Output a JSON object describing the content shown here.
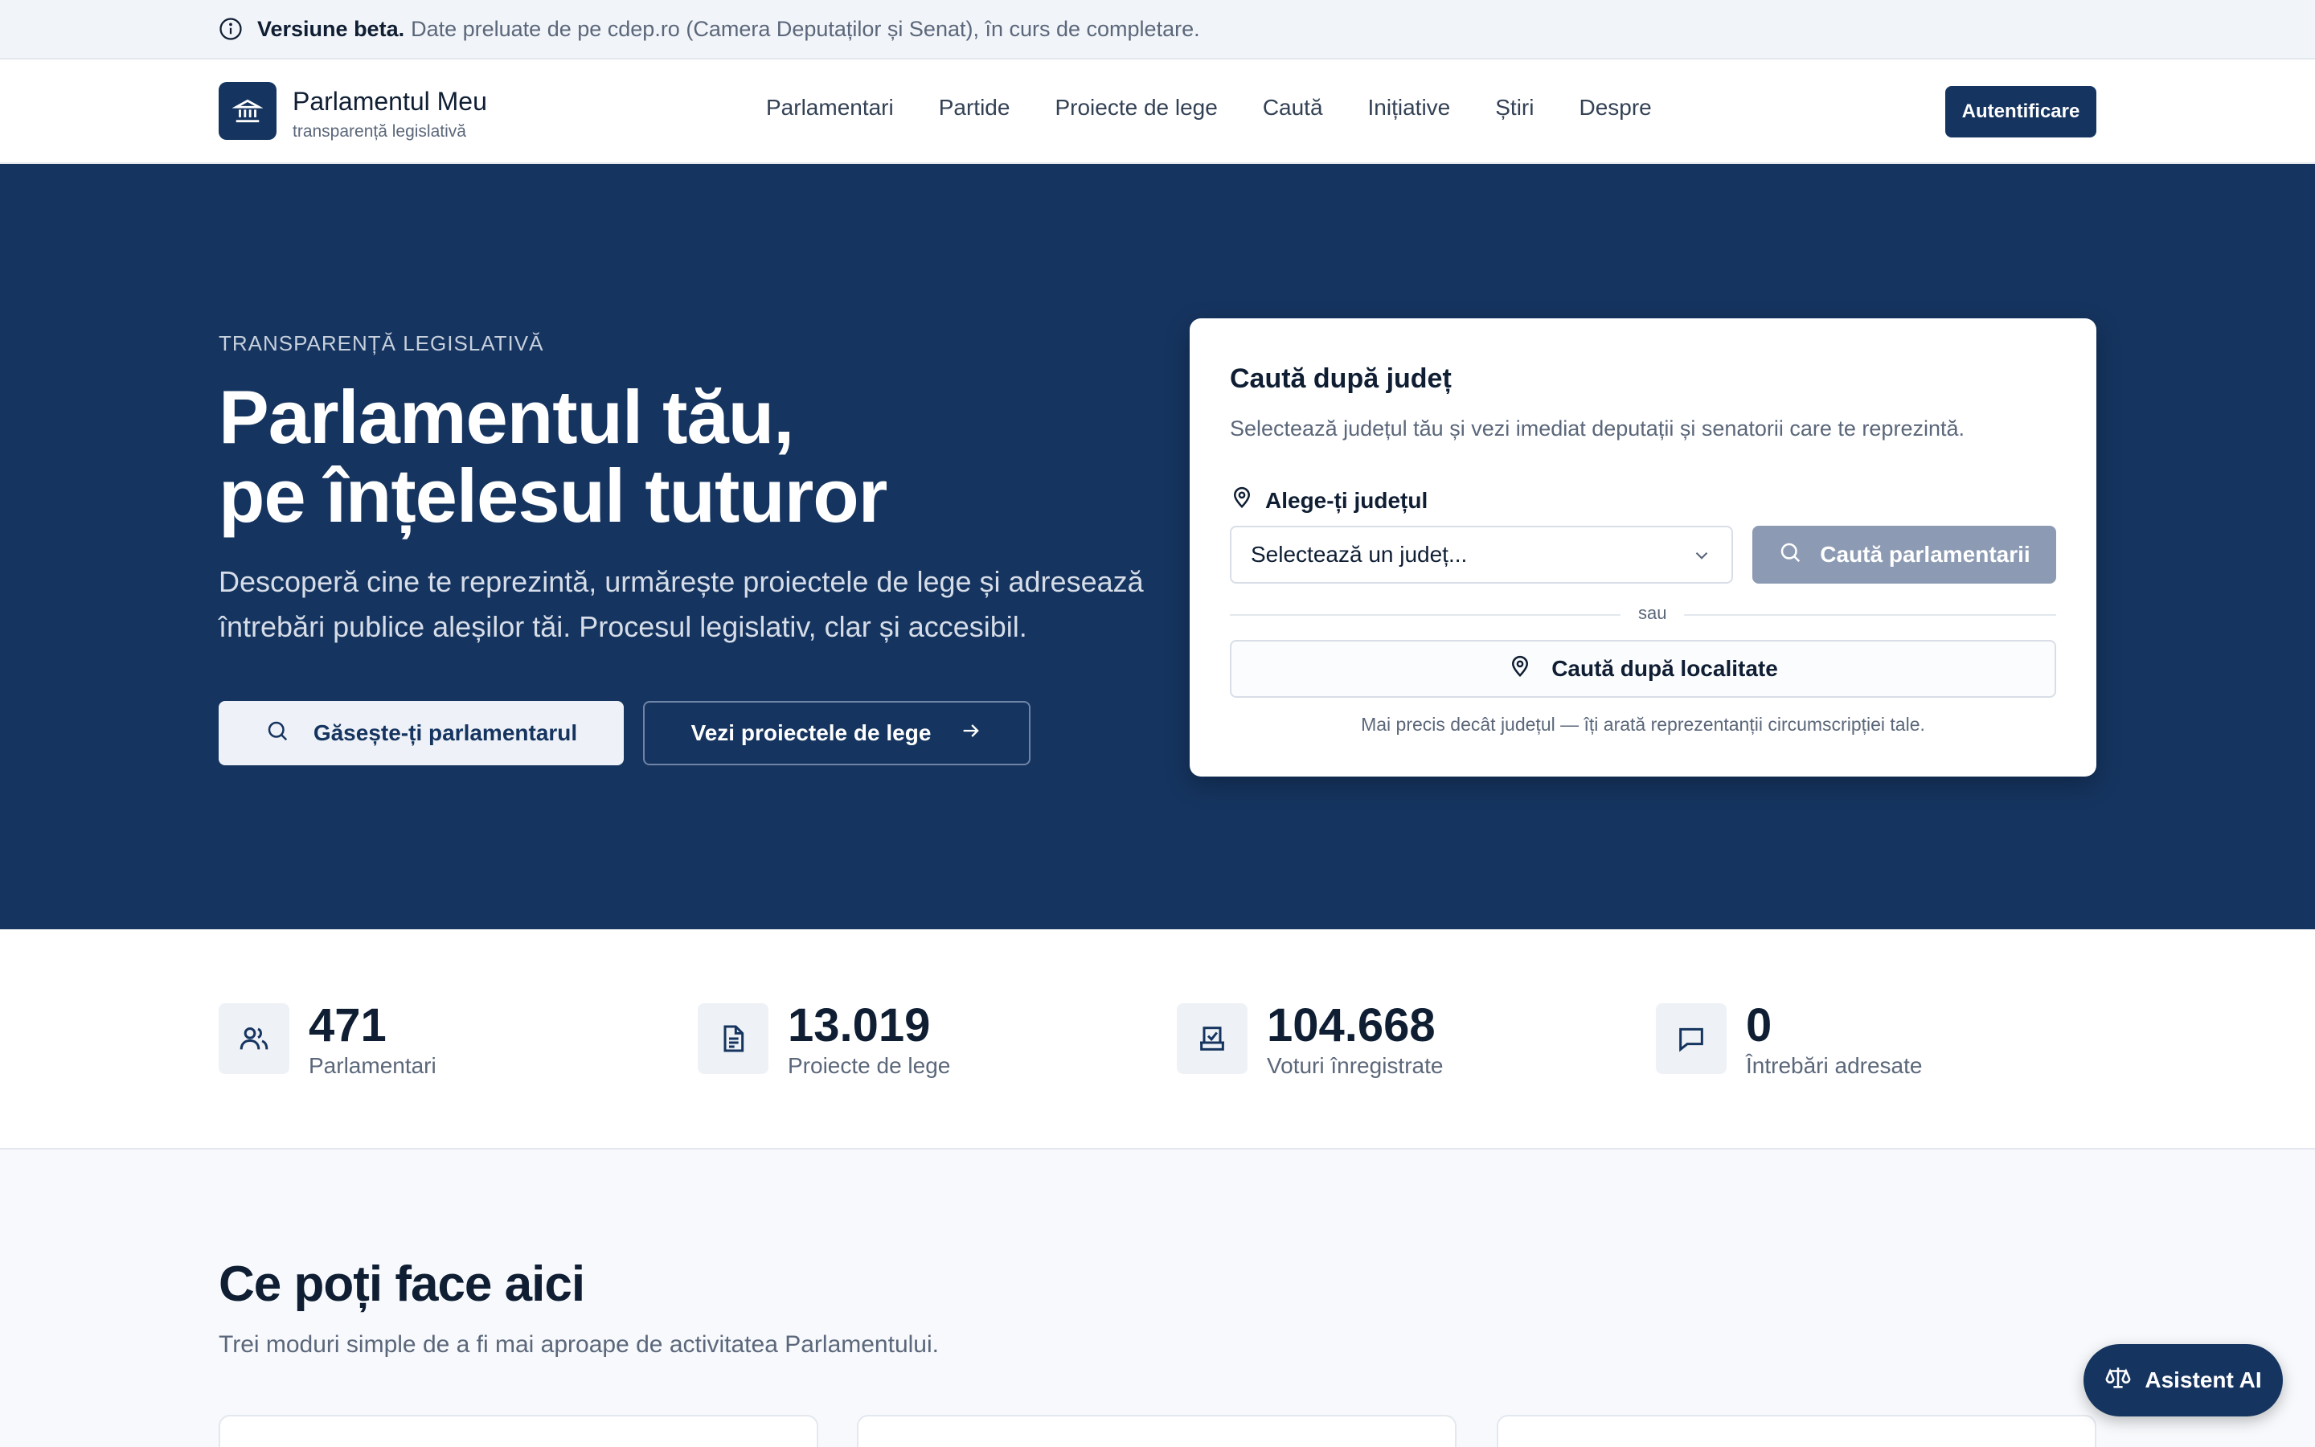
{
  "beta_bar": {
    "icon": "info-icon",
    "label": "Versiune beta.",
    "text": "Date preluate de pe cdep.ro (Camera Deputaților și Senat), în curs de completare."
  },
  "header": {
    "logo_icon": "institution-icon",
    "title": "Parlamentul Meu",
    "subtitle": "transparență legislativă",
    "nav": [
      "Parlamentari",
      "Partide",
      "Proiecte de lege",
      "Caută",
      "Inițiative",
      "Știri",
      "Despre"
    ],
    "login_label": "Autentificare"
  },
  "hero": {
    "eyebrow": "TRANSPARENȚĂ LEGISLATIVĂ",
    "title_line1": "Parlamentul tău,",
    "title_line2": "pe înțelesul tuturor",
    "description": "Descoperă cine te reprezintă, urmărește proiectele de lege și adresează întrebări publice aleșilor tăi. Procesul legislativ, clar și accesibil.",
    "find_button": "Găsește-ți parlamentarul",
    "projects_button": "Vezi proiectele de lege"
  },
  "search_card": {
    "title": "Caută după județ",
    "description": "Selectează județul tău și vezi imediat deputații și senatorii care te reprezintă.",
    "county_label": "Alege-ți județul",
    "select_placeholder": "Selectează un județ...",
    "search_button": "Caută parlamentarii",
    "divider": "sau",
    "locality_button": "Caută după localitate",
    "hint": "Mai precis decât județul — îți arată reprezentanții circumscripției tale."
  },
  "stats": [
    {
      "icon": "users-icon",
      "value": "471",
      "label": "Parlamentari"
    },
    {
      "icon": "document-icon",
      "value": "13.019",
      "label": "Proiecte de lege"
    },
    {
      "icon": "ballot-box-icon",
      "value": "104.668",
      "label": "Voturi înregistrate"
    },
    {
      "icon": "chat-bubble-icon",
      "value": "0",
      "label": "Întrebări adresate"
    }
  ],
  "section": {
    "title": "Ce poți face aici",
    "subtitle": "Trei moduri simple de a fi mai aproape de activitatea Parlamentului."
  },
  "ai_assistant": {
    "icon": "scales-icon",
    "label": "Asistent AI"
  },
  "colors": {
    "primary": "#15345f",
    "muted_button": "#8c9bb3",
    "background": "#f7f9fc"
  }
}
